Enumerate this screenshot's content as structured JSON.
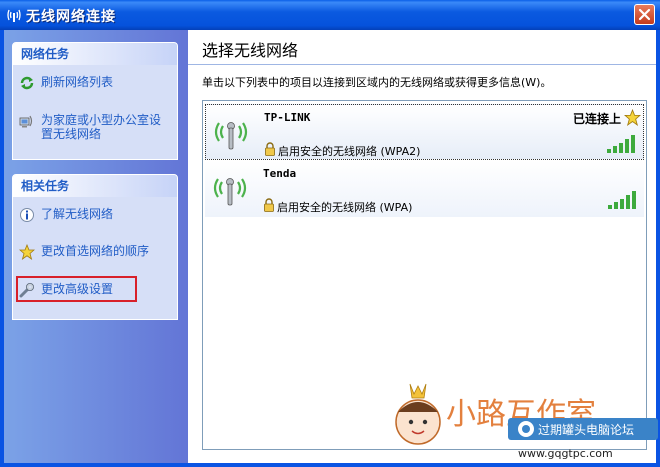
{
  "window": {
    "title": "无线网络连接"
  },
  "network_tasks": {
    "heading": "网络任务",
    "items": [
      {
        "label_line1": "刷新网络列表",
        "label_line2": ""
      },
      {
        "label_line1": "为家庭或小型办公室设",
        "label_line2": "置无线网络"
      }
    ]
  },
  "related_tasks": {
    "heading": "相关任务",
    "items": [
      {
        "label": "了解无线网络"
      },
      {
        "label": "更改首选网络的顺序"
      },
      {
        "label": "更改高级设置"
      }
    ]
  },
  "main": {
    "title": "选择无线网络",
    "description": "单击以下列表中的项目以连接到区域内的无线网络或获得更多信息(W)。",
    "networks": [
      {
        "ssid": "TP-LINK",
        "status": "已连接上",
        "security": "启用安全的无线网络 (WPA2)",
        "signal_bars": 5
      },
      {
        "ssid": "Tenda",
        "status": "",
        "security": "启用安全的无线网络 (WPA)",
        "signal_bars": 5
      }
    ]
  },
  "watermark": {
    "brand": "小路互作室",
    "forum": "过期罐头电脑论坛",
    "url": "www.gqgtpc.com"
  },
  "colors": {
    "titlebar": "#0552dc",
    "task_link": "#215dc6",
    "highlight_box": "#d8202a"
  }
}
